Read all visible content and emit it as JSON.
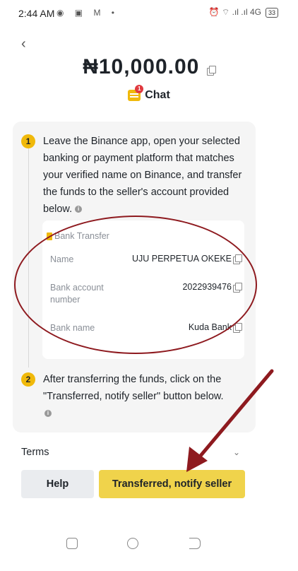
{
  "status_bar": {
    "time": "2:44 AM",
    "left_icons": "◉ ▣ M •",
    "right_icons": "⏰ ⌔ .ıl .ıl 4G",
    "battery": "33"
  },
  "header": {
    "back_icon": "chevron-left-icon",
    "amount": "₦10,000.00",
    "chat_label": "Chat",
    "chat_badge": "1"
  },
  "steps": [
    {
      "number": "1",
      "text": "Leave the Binance app, open your selected banking or payment platform that matches your verified name on Binance, and transfer the funds to the seller's account provided below."
    },
    {
      "number": "2",
      "text": "After transferring the funds, click on the \"Transferred, notify seller\" button below."
    }
  ],
  "bank_transfer": {
    "title": "Bank Transfer",
    "fields": [
      {
        "label": "Name",
        "value": "UJU PERPETUA OKEKE"
      },
      {
        "label": "Bank account number",
        "value": "2022939476"
      },
      {
        "label": "Bank name",
        "value": "Kuda Bank"
      }
    ]
  },
  "footer": {
    "terms_label": "Terms",
    "help_label": "Help",
    "notify_label": "Transferred, notify seller"
  },
  "colors": {
    "accent": "#f0b90b",
    "button_yellow": "#f0d34b",
    "annotation_red": "#8e1a1f"
  }
}
